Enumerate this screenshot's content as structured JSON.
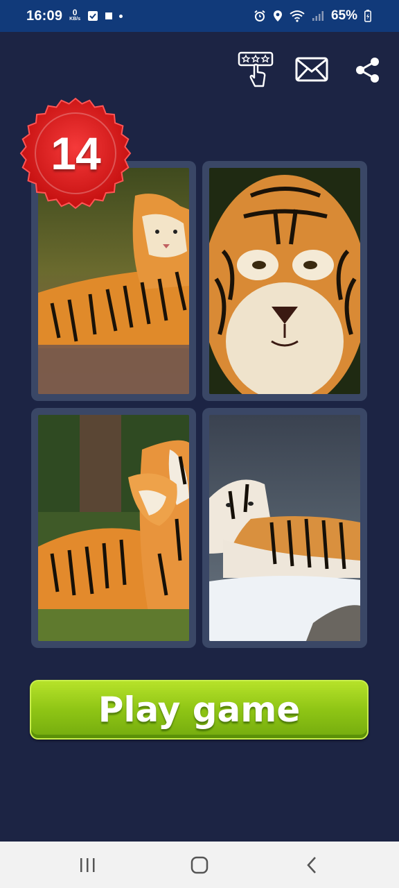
{
  "status_bar": {
    "time": "16:09",
    "net_speed_value": "0",
    "net_speed_unit": "KB/s",
    "battery": "65%"
  },
  "toolbar": {
    "icons": [
      "rate-stars-icon",
      "mail-icon",
      "share-icon"
    ]
  },
  "level": {
    "number": "14"
  },
  "puzzle": {
    "images": [
      "tiger-lying-in-grass",
      "tiger-face-closeup",
      "tiger-cub-with-mother",
      "white-tiger-in-snow"
    ]
  },
  "play_button": {
    "label": "Play game"
  },
  "colors": {
    "background": "#1c2444",
    "status_bar": "#113a7a",
    "tile_frame": "#3a4766",
    "badge_red": "#e01b1b",
    "play_green": "#8fc515"
  },
  "nav_bar": {
    "icons": [
      "recent-apps-icon",
      "home-icon",
      "back-icon"
    ]
  }
}
